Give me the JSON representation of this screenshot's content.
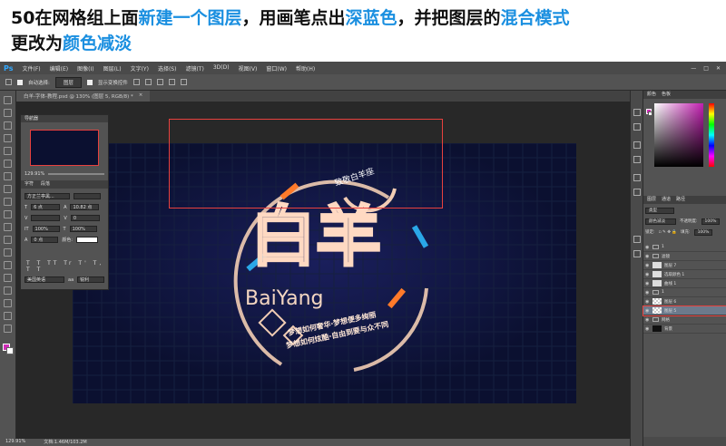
{
  "instruction": {
    "parts": [
      {
        "text": "50在网格组上面",
        "hl": false
      },
      {
        "text": "新建一个图层",
        "hl": true
      },
      {
        "text": "，用画笔点出",
        "hl": false
      },
      {
        "text": "深蓝色",
        "hl": true
      },
      {
        "text": "，并把图层的",
        "hl": false
      },
      {
        "text": "混合模式",
        "hl": true
      },
      {
        "text": "更改为",
        "hl": false
      },
      {
        "text": "颜色减淡",
        "hl": true
      }
    ],
    "highlight_color": "#1a8fe0"
  },
  "menubar": {
    "logo": "Ps",
    "items": [
      "文件(F)",
      "编辑(E)",
      "图像(I)",
      "图层(L)",
      "文字(Y)",
      "选择(S)",
      "滤镜(T)",
      "3D(D)",
      "视图(V)",
      "窗口(W)",
      "帮助(H)"
    ],
    "window_controls": [
      "—",
      "□",
      "✕"
    ]
  },
  "options_bar": {
    "auto_select_label": "自动选择:",
    "auto_select_value": "图层",
    "show_transform_label": "显示变换控件"
  },
  "document_tab": {
    "title": "白羊-字体-教程.psd @ 130% (图层 5, RGB/8) *",
    "close": "×"
  },
  "status_bar": {
    "zoom": "129.91%",
    "doc": "文档:1.46M/103.2M"
  },
  "navigator": {
    "title": "导航器",
    "zoom": "129.91%",
    "character_tabs": [
      "字符",
      "段落"
    ],
    "font_family": "方正兰亭黑...",
    "font_size": "6 点",
    "leading": "10.82 点",
    "tracking": "0",
    "scale_v": "100%",
    "scale_h": "100%",
    "baseline": "0 点",
    "color_label": "颜色:",
    "style_chars": "T T TT Tr T' T, T T",
    "language": "美国英语",
    "aa": "锐利"
  },
  "color_panel": {
    "tabs": [
      "颜色",
      "色板"
    ],
    "foreground": "#d02cb8",
    "background": "#ffffff"
  },
  "layers_panel": {
    "tabs": [
      "图层",
      "通道",
      "路径"
    ],
    "kind_label": "类型",
    "blend_mode": "颜色减淡",
    "opacity_label": "不透明度:",
    "opacity": "100%",
    "lock_label": "锁定:",
    "fill_label": "填充:",
    "fill": "100%",
    "layers": [
      {
        "name": "1",
        "kind": "folder",
        "visible": true
      },
      {
        "name": "滤镜",
        "kind": "folder",
        "visible": true
      },
      {
        "name": "图层 7",
        "kind": "layer",
        "visible": true
      },
      {
        "name": "选取颜色 1",
        "kind": "adjust",
        "visible": true
      },
      {
        "name": "曲线 1",
        "kind": "adjust",
        "visible": true
      },
      {
        "name": "1",
        "kind": "folder",
        "visible": true
      },
      {
        "name": "图层 6",
        "kind": "check",
        "visible": true
      },
      {
        "name": "图层 5",
        "kind": "check",
        "visible": true,
        "active": true
      },
      {
        "name": "网格",
        "kind": "folder",
        "visible": true
      },
      {
        "name": "背景",
        "kind": "dark",
        "visible": true
      }
    ]
  },
  "canvas": {
    "main_text": "白羊",
    "sub_text": "BaiYang",
    "tag_text": "致敬白羊座",
    "slogan_line1": "梦想如何奢华·梦想便多绚丽",
    "slogan_line2": "梦想如何炫酷·自由到要与众不同"
  }
}
